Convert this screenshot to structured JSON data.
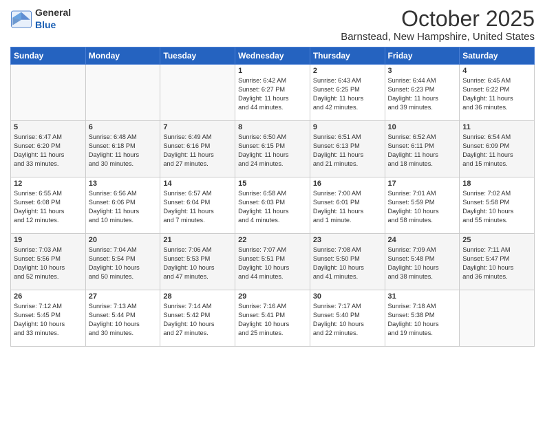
{
  "header": {
    "logo_general": "General",
    "logo_blue": "Blue",
    "month": "October 2025",
    "location": "Barnstead, New Hampshire, United States"
  },
  "days_of_week": [
    "Sunday",
    "Monday",
    "Tuesday",
    "Wednesday",
    "Thursday",
    "Friday",
    "Saturday"
  ],
  "weeks": [
    [
      {
        "day": "",
        "text": ""
      },
      {
        "day": "",
        "text": ""
      },
      {
        "day": "",
        "text": ""
      },
      {
        "day": "1",
        "text": "Sunrise: 6:42 AM\nSunset: 6:27 PM\nDaylight: 11 hours\nand 44 minutes."
      },
      {
        "day": "2",
        "text": "Sunrise: 6:43 AM\nSunset: 6:25 PM\nDaylight: 11 hours\nand 42 minutes."
      },
      {
        "day": "3",
        "text": "Sunrise: 6:44 AM\nSunset: 6:23 PM\nDaylight: 11 hours\nand 39 minutes."
      },
      {
        "day": "4",
        "text": "Sunrise: 6:45 AM\nSunset: 6:22 PM\nDaylight: 11 hours\nand 36 minutes."
      }
    ],
    [
      {
        "day": "5",
        "text": "Sunrise: 6:47 AM\nSunset: 6:20 PM\nDaylight: 11 hours\nand 33 minutes."
      },
      {
        "day": "6",
        "text": "Sunrise: 6:48 AM\nSunset: 6:18 PM\nDaylight: 11 hours\nand 30 minutes."
      },
      {
        "day": "7",
        "text": "Sunrise: 6:49 AM\nSunset: 6:16 PM\nDaylight: 11 hours\nand 27 minutes."
      },
      {
        "day": "8",
        "text": "Sunrise: 6:50 AM\nSunset: 6:15 PM\nDaylight: 11 hours\nand 24 minutes."
      },
      {
        "day": "9",
        "text": "Sunrise: 6:51 AM\nSunset: 6:13 PM\nDaylight: 11 hours\nand 21 minutes."
      },
      {
        "day": "10",
        "text": "Sunrise: 6:52 AM\nSunset: 6:11 PM\nDaylight: 11 hours\nand 18 minutes."
      },
      {
        "day": "11",
        "text": "Sunrise: 6:54 AM\nSunset: 6:09 PM\nDaylight: 11 hours\nand 15 minutes."
      }
    ],
    [
      {
        "day": "12",
        "text": "Sunrise: 6:55 AM\nSunset: 6:08 PM\nDaylight: 11 hours\nand 12 minutes."
      },
      {
        "day": "13",
        "text": "Sunrise: 6:56 AM\nSunset: 6:06 PM\nDaylight: 11 hours\nand 10 minutes."
      },
      {
        "day": "14",
        "text": "Sunrise: 6:57 AM\nSunset: 6:04 PM\nDaylight: 11 hours\nand 7 minutes."
      },
      {
        "day": "15",
        "text": "Sunrise: 6:58 AM\nSunset: 6:03 PM\nDaylight: 11 hours\nand 4 minutes."
      },
      {
        "day": "16",
        "text": "Sunrise: 7:00 AM\nSunset: 6:01 PM\nDaylight: 11 hours\nand 1 minute."
      },
      {
        "day": "17",
        "text": "Sunrise: 7:01 AM\nSunset: 5:59 PM\nDaylight: 10 hours\nand 58 minutes."
      },
      {
        "day": "18",
        "text": "Sunrise: 7:02 AM\nSunset: 5:58 PM\nDaylight: 10 hours\nand 55 minutes."
      }
    ],
    [
      {
        "day": "19",
        "text": "Sunrise: 7:03 AM\nSunset: 5:56 PM\nDaylight: 10 hours\nand 52 minutes."
      },
      {
        "day": "20",
        "text": "Sunrise: 7:04 AM\nSunset: 5:54 PM\nDaylight: 10 hours\nand 50 minutes."
      },
      {
        "day": "21",
        "text": "Sunrise: 7:06 AM\nSunset: 5:53 PM\nDaylight: 10 hours\nand 47 minutes."
      },
      {
        "day": "22",
        "text": "Sunrise: 7:07 AM\nSunset: 5:51 PM\nDaylight: 10 hours\nand 44 minutes."
      },
      {
        "day": "23",
        "text": "Sunrise: 7:08 AM\nSunset: 5:50 PM\nDaylight: 10 hours\nand 41 minutes."
      },
      {
        "day": "24",
        "text": "Sunrise: 7:09 AM\nSunset: 5:48 PM\nDaylight: 10 hours\nand 38 minutes."
      },
      {
        "day": "25",
        "text": "Sunrise: 7:11 AM\nSunset: 5:47 PM\nDaylight: 10 hours\nand 36 minutes."
      }
    ],
    [
      {
        "day": "26",
        "text": "Sunrise: 7:12 AM\nSunset: 5:45 PM\nDaylight: 10 hours\nand 33 minutes."
      },
      {
        "day": "27",
        "text": "Sunrise: 7:13 AM\nSunset: 5:44 PM\nDaylight: 10 hours\nand 30 minutes."
      },
      {
        "day": "28",
        "text": "Sunrise: 7:14 AM\nSunset: 5:42 PM\nDaylight: 10 hours\nand 27 minutes."
      },
      {
        "day": "29",
        "text": "Sunrise: 7:16 AM\nSunset: 5:41 PM\nDaylight: 10 hours\nand 25 minutes."
      },
      {
        "day": "30",
        "text": "Sunrise: 7:17 AM\nSunset: 5:40 PM\nDaylight: 10 hours\nand 22 minutes."
      },
      {
        "day": "31",
        "text": "Sunrise: 7:18 AM\nSunset: 5:38 PM\nDaylight: 10 hours\nand 19 minutes."
      },
      {
        "day": "",
        "text": ""
      }
    ]
  ]
}
